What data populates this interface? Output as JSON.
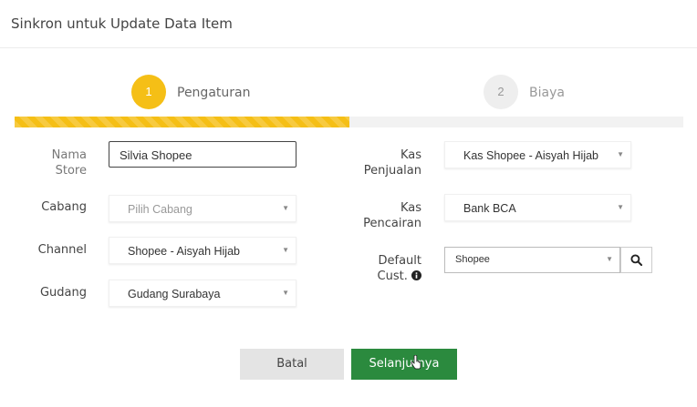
{
  "window": {
    "title": "Sinkron untuk Update Data Item"
  },
  "steps": [
    {
      "number": "1",
      "label": "Pengaturan",
      "active": true
    },
    {
      "number": "2",
      "label": "Biaya",
      "active": false
    }
  ],
  "progress": {
    "fraction": 0.5
  },
  "form": {
    "nama_store": {
      "label_line1": "Nama",
      "label_line2": "Store",
      "value": "Silvia Shopee"
    },
    "cabang": {
      "label": "Cabang",
      "value": "Pilih Cabang"
    },
    "channel": {
      "label": "Channel",
      "value": "Shopee - Aisyah Hijab"
    },
    "gudang": {
      "label": "Gudang",
      "value": "Gudang Surabaya"
    },
    "kas_penjualan": {
      "label_line1": "Kas",
      "label_line2": "Penjualan",
      "value": "Kas Shopee - Aisyah Hijab"
    },
    "kas_pencairan": {
      "label_line1": "Kas",
      "label_line2": "Pencairan",
      "value": "Bank BCA"
    },
    "default_cust": {
      "label_line1": "Default",
      "label_line2": "Cust.",
      "value": "Shopee"
    }
  },
  "buttons": {
    "cancel": "Batal",
    "next": "Selanjutnya"
  },
  "colors": {
    "accent": "#f5bf16",
    "primary": "#2b8a3e",
    "cancel_bg": "#e4e4e4"
  },
  "icons": {
    "select_caret": "caret-down-icon",
    "search": "search-icon",
    "info": "info-icon"
  }
}
